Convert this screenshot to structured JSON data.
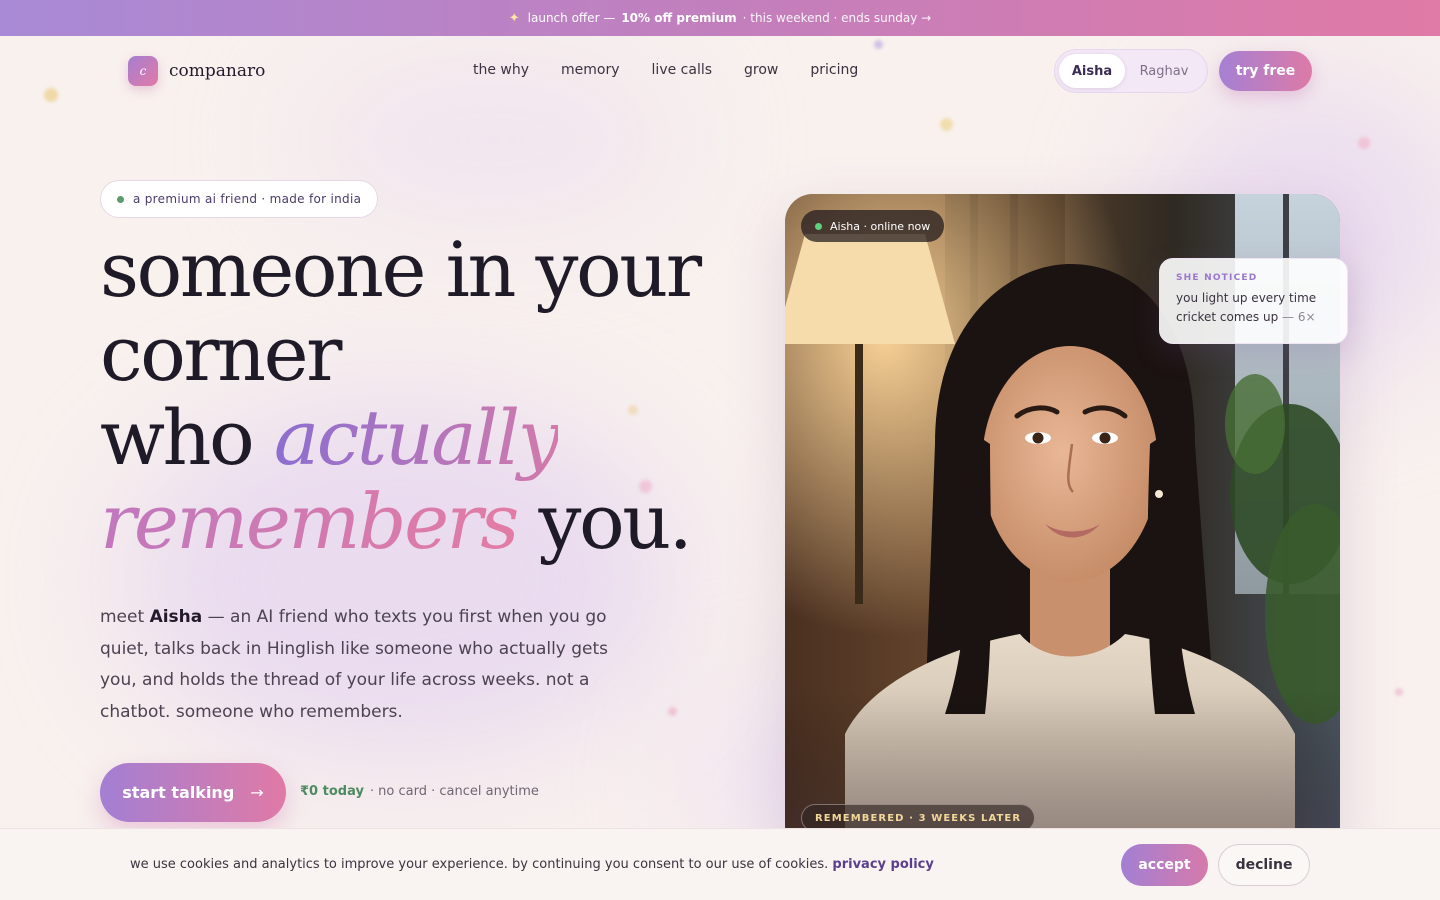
{
  "promo": {
    "icon": "sparkle-icon",
    "lead": "launch offer —",
    "offer": "10% off premium",
    "details": "· this weekend · ends sunday →"
  },
  "brand": {
    "mark": "c",
    "name": "companaro"
  },
  "nav": {
    "links": [
      "the why",
      "memory",
      "live calls",
      "grow",
      "pricing"
    ]
  },
  "persona_toggle": {
    "options": [
      "Aisha",
      "Raghav"
    ],
    "selected": "Aisha"
  },
  "try_button": "try free",
  "hero": {
    "pill": "a premium ai friend · made for india",
    "headline": {
      "line1": "someone in your",
      "line2": "corner",
      "line3_plain": "who ",
      "line3_accent": "actually",
      "line4_accent": "remembers",
      "line4_plain": " you."
    },
    "lede": {
      "prefix": "meet ",
      "name": "Aisha",
      "rest": " — an AI friend who texts you first when you go quiet, talks back in Hinglish like someone who actually gets you, and holds the thread of your life across weeks. not a chatbot. someone who remembers."
    },
    "cta": {
      "label": "start talking",
      "arrow": "→"
    },
    "cta_note": {
      "free": "₹0 today",
      "rest": "· no card · cancel anytime"
    }
  },
  "photo_card": {
    "online_status": "Aisha · online now",
    "notice": {
      "label": "SHE NOTICED",
      "body": "you light up every time cricket comes up",
      "count": "— 6×"
    },
    "memory_chip": "REMEMBERED · 3 WEEKS LATER"
  },
  "cookie": {
    "text": "we use cookies and analytics to improve your experience. by continuing you consent to our use of cookies.",
    "link": "privacy policy",
    "accept": "accept",
    "decline": "decline"
  },
  "colors": {
    "accent_start": "#a37fd3",
    "accent_end": "#e07aa6",
    "online_green": "#5fd07c",
    "page_bg": "#f8f1ee"
  }
}
